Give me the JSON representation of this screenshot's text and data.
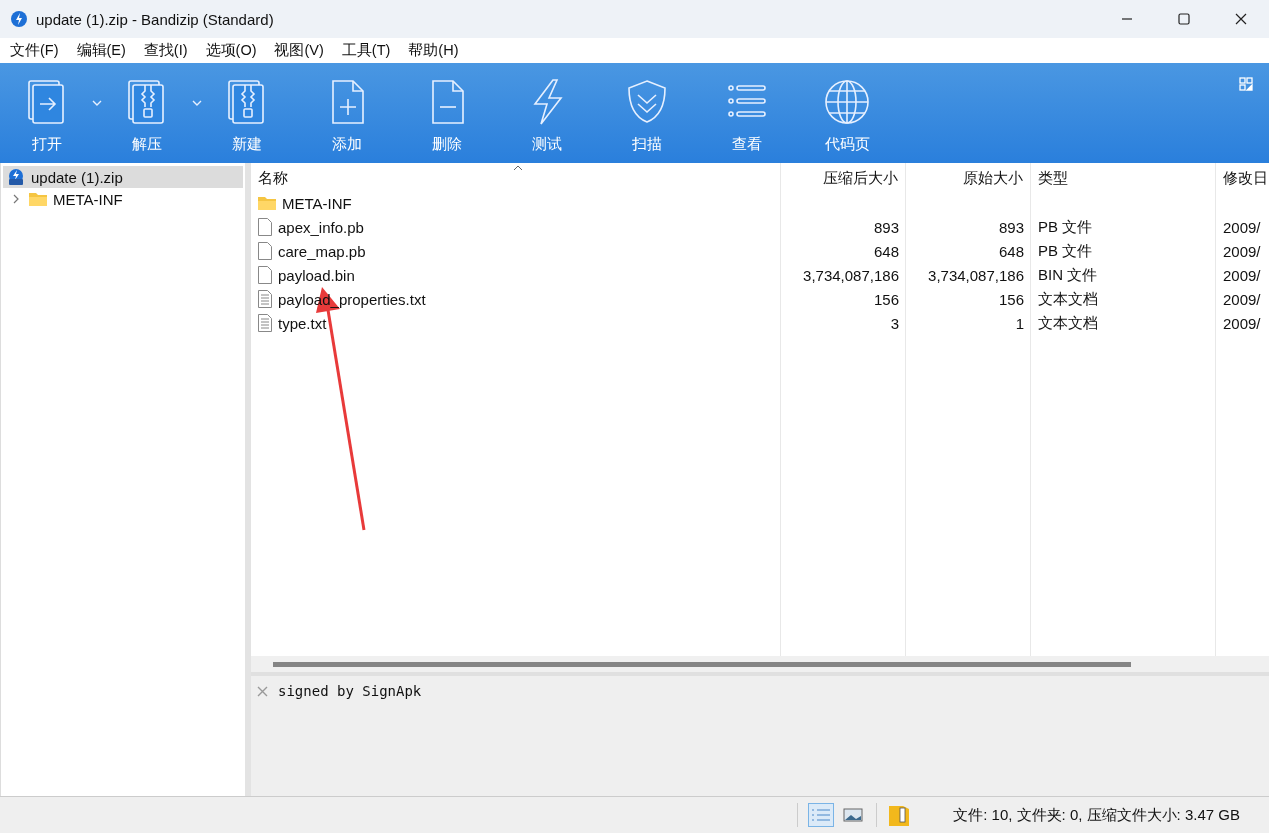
{
  "window": {
    "title": "update (1).zip - Bandizip (Standard)"
  },
  "menu": [
    "文件(F)",
    "编辑(E)",
    "查找(I)",
    "选项(O)",
    "视图(V)",
    "工具(T)",
    "帮助(H)"
  ],
  "toolbar": [
    {
      "label": "打开",
      "dropdown": true
    },
    {
      "label": "解压",
      "dropdown": true
    },
    {
      "label": "新建",
      "dropdown": false
    },
    {
      "label": "添加",
      "dropdown": false
    },
    {
      "label": "删除",
      "dropdown": false
    },
    {
      "label": "测试",
      "dropdown": false
    },
    {
      "label": "扫描",
      "dropdown": false
    },
    {
      "label": "查看",
      "dropdown": false
    },
    {
      "label": "代码页",
      "dropdown": false
    }
  ],
  "tree": [
    {
      "label": "update (1).zip",
      "kind": "archive",
      "selected": true,
      "children": [
        {
          "label": "META-INF",
          "kind": "folder",
          "selected": false,
          "expanded": false
        }
      ]
    }
  ],
  "table": {
    "columns": [
      {
        "label": "名称",
        "sorted": true
      },
      {
        "label": "压缩后大小",
        "sorted": false
      },
      {
        "label": "原始大小",
        "sorted": false
      },
      {
        "label": "类型",
        "sorted": false
      },
      {
        "label": "修改日",
        "sorted": false
      }
    ],
    "rows": [
      {
        "kind": "folder",
        "cells": [
          "META-INF",
          "",
          "",
          "",
          ""
        ]
      },
      {
        "kind": "file",
        "cells": [
          "apex_info.pb",
          "893",
          "893",
          "PB 文件",
          "2009/"
        ]
      },
      {
        "kind": "file",
        "cells": [
          "care_map.pb",
          "648",
          "648",
          "PB 文件",
          "2009/"
        ]
      },
      {
        "kind": "file",
        "cells": [
          "payload.bin",
          "3,734,087,186",
          "3,734,087,186",
          "BIN 文件",
          "2009/"
        ]
      },
      {
        "kind": "text",
        "cells": [
          "payload_properties.txt",
          "156",
          "156",
          "文本文档",
          "2009/"
        ]
      },
      {
        "kind": "text",
        "cells": [
          "type.txt",
          "3",
          "1",
          "文本文档",
          "2009/"
        ]
      }
    ]
  },
  "comment": {
    "text": "signed by SignApk"
  },
  "status_bar": {
    "view_buttons": [
      {
        "selected": true
      },
      {
        "selected": false
      }
    ],
    "text": "文件: 10, 文件夹: 0, 压缩文件大小: 3.47 GB"
  }
}
